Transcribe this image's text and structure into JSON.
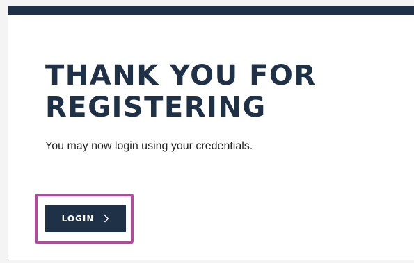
{
  "page": {
    "heading_line1": "THANK YOU FOR",
    "heading_line2": "REGISTERING",
    "message": "You may now login using your credentials."
  },
  "login_button": {
    "label": "LOGIN",
    "icon": "chevron-right-icon"
  },
  "colors": {
    "brand_navy": "#1f3147",
    "highlight": "#b04c9c",
    "text": "#222222"
  }
}
